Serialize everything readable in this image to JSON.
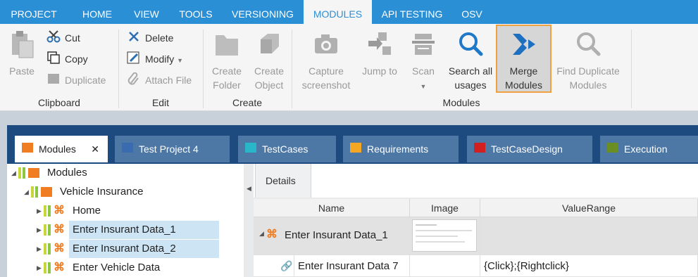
{
  "menu": {
    "tabs": [
      {
        "label": "PROJECT"
      },
      {
        "label": "HOME"
      },
      {
        "label": "VIEW"
      },
      {
        "label": "TOOLS"
      },
      {
        "label": "VERSIONING"
      },
      {
        "label": "MODULES",
        "active": true
      },
      {
        "label": "API TESTING"
      },
      {
        "label": "OSV"
      }
    ]
  },
  "ribbon": {
    "clipboard": {
      "label": "Clipboard",
      "paste": "Paste",
      "cut": "Cut",
      "copy": "Copy",
      "duplicate": "Duplicate"
    },
    "edit": {
      "label": "Edit",
      "delete": "Delete",
      "modify": "Modify",
      "attach_file": "Attach File"
    },
    "create": {
      "label": "Create",
      "create_folder_1": "Create",
      "create_folder_2": "Folder",
      "create_object_1": "Create",
      "create_object_2": "Object"
    },
    "modules": {
      "label": "Modules",
      "capture_1": "Capture",
      "capture_2": "screenshot",
      "jump_to": "Jump to",
      "scan": "Scan",
      "search_1": "Search all",
      "search_2": "usages",
      "merge_1": "Merge",
      "merge_2": "Modules",
      "find_dup_1": "Find Duplicate",
      "find_dup_2": "Modules"
    }
  },
  "doc_tabs": [
    {
      "label": "Modules",
      "close": "✕",
      "color": "#f07d22"
    },
    {
      "label": "Test Project 4",
      "color": "#3a6bb0"
    },
    {
      "label": "TestCases",
      "color": "#2ab6c9"
    },
    {
      "label": "Requirements",
      "color": "#f5a623"
    },
    {
      "label": "TestCaseDesign",
      "color": "#d21f1f"
    },
    {
      "label": "Execution",
      "color": "#6b8e23"
    }
  ],
  "tree": {
    "items": [
      {
        "label": "Modules"
      },
      {
        "label": "Vehicle Insurance"
      },
      {
        "label": "Home"
      },
      {
        "label": "Enter Insurant Data_1"
      },
      {
        "label": "Enter Insurant Data_2"
      },
      {
        "label": "Enter Vehicle Data"
      }
    ]
  },
  "details": {
    "tab_label": "Details",
    "columns": [
      "Name",
      "Image",
      "ValueRange"
    ],
    "rows": [
      {
        "name": "Enter Insurant Data_1",
        "image": "thumbnail",
        "value_range": ""
      },
      {
        "name": "Enter Insurant Data 7",
        "image": "",
        "value_range": "{Click};{Rightclick}"
      }
    ]
  },
  "colors": {
    "accent": "#2b8fd6",
    "module_orange": "#f07d22",
    "status_green": "#8dc63f",
    "highlight_border": "#f0a040",
    "workspace_dark": "#1d4a7f"
  }
}
